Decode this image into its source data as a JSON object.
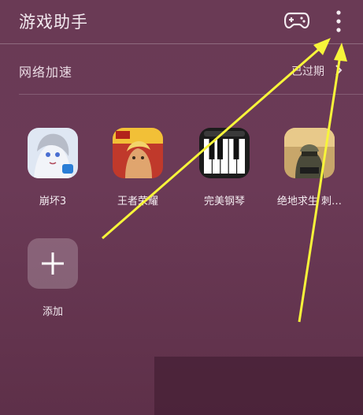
{
  "header": {
    "title": "游戏助手",
    "gamepad_icon": "gamepad-icon",
    "more_icon": "more-vertical-icon"
  },
  "speed": {
    "label": "网络加速",
    "status": "已过期",
    "chevron_icon": "chevron-right-icon"
  },
  "apps": [
    {
      "label": "崩坏3",
      "icon": "honkai-impact-3-icon"
    },
    {
      "label": "王者荣耀",
      "icon": "honor-of-kings-icon"
    },
    {
      "label": "完美钢琴",
      "icon": "perfect-piano-icon"
    },
    {
      "label": "绝地求生 刺…",
      "icon": "pubg-icon"
    }
  ],
  "add": {
    "label": "添加",
    "icon": "plus-icon"
  },
  "colors": {
    "background": "#6a3a55",
    "arrow": "#f7f53a"
  }
}
